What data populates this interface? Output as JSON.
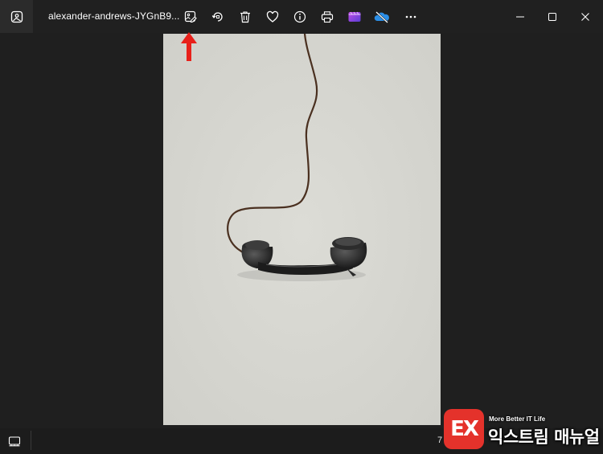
{
  "titlebar": {
    "file_name": "alexander-andrews-JYGnB9...",
    "toolbar_icons": [
      "edit-image-icon",
      "rotate-icon",
      "delete-icon",
      "favorite-heart-icon",
      "info-icon",
      "print-icon",
      "clipchamp-icon",
      "onedrive-sync-off-icon",
      "more-options-icon"
    ],
    "window_controls": [
      "minimize-icon",
      "maximize-icon",
      "close-icon"
    ]
  },
  "annotation": {
    "color": "#e8201a",
    "points_to": "edit-image-icon"
  },
  "bottombar": {
    "zoom_text": "7"
  },
  "watermark": {
    "badge": "EX",
    "tagline": "More Better IT Life",
    "name": "익스트림 매뉴얼"
  },
  "colors": {
    "window_bg": "#1f1f1f",
    "photo_bg": "#d5d5d0",
    "accent_red": "#e4322b"
  }
}
